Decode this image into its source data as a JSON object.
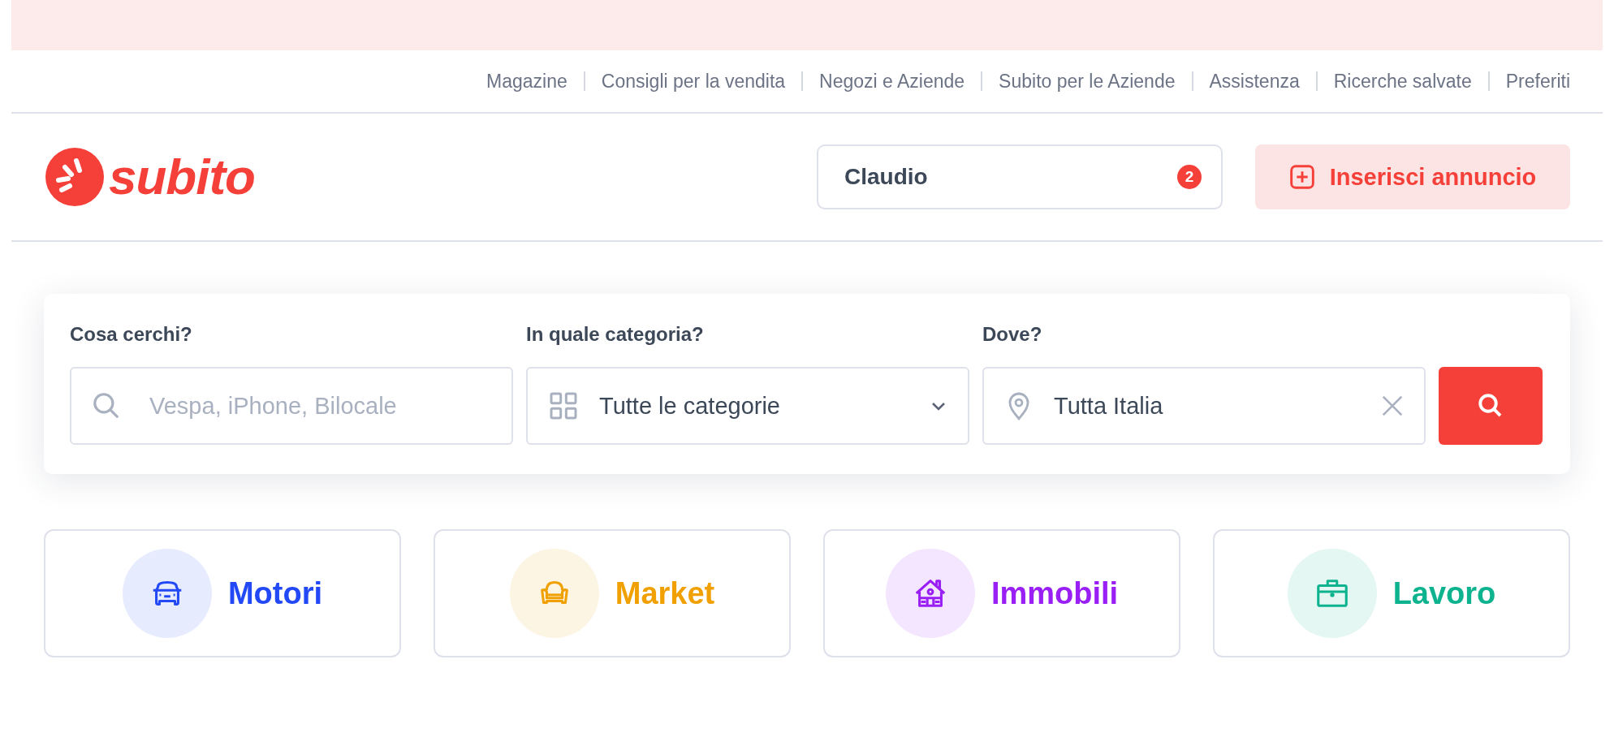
{
  "top_links": [
    "Magazine",
    "Consigli per la vendita",
    "Negozi e Aziende",
    "Subito per le Aziende",
    "Assistenza",
    "Ricerche salvate",
    "Preferiti"
  ],
  "logo": {
    "text": "subito"
  },
  "user_menu": {
    "name": "Claudio",
    "badge": "2"
  },
  "post_button": {
    "label": "Inserisci annuncio"
  },
  "search": {
    "fields": [
      {
        "kind": "text",
        "label": "Cosa cerchi?",
        "placeholder": "Vespa, iPhone, Bilocale"
      },
      {
        "kind": "category",
        "label": "In quale categoria?",
        "value": "Tutte le categorie"
      },
      {
        "kind": "location",
        "label": "Dove?",
        "value": "Tutta Italia"
      }
    ]
  },
  "categories": [
    {
      "kind": "car",
      "label": "Motori",
      "color": "#2249f5"
    },
    {
      "kind": "armchair",
      "label": "Market",
      "color": "#f0a000"
    },
    {
      "kind": "house",
      "label": "Immobili",
      "color": "#9a1ff5"
    },
    {
      "kind": "briefcase",
      "label": "Lavoro",
      "color": "#0db38e"
    }
  ]
}
